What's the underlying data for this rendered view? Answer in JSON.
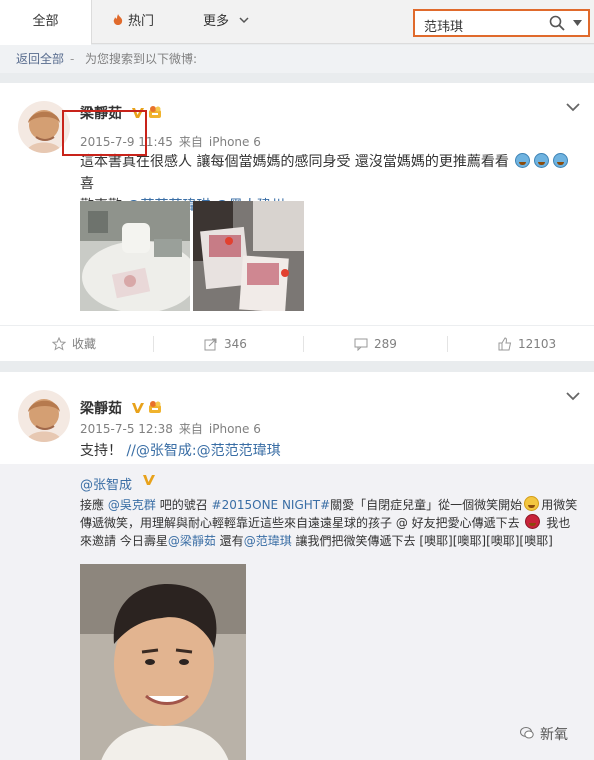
{
  "tabs": {
    "all": "全部",
    "hot": "热门",
    "more": "更多"
  },
  "search": {
    "value": "范玮琪"
  },
  "backbar": {
    "back": "返回全部",
    "sep": "-",
    "note": "为您搜索到以下微博:"
  },
  "post1": {
    "user": "梁靜茹",
    "date": "2015-7-9 11:45",
    "source_prefix": "来自",
    "source": "iPhone 6",
    "text_a": "這本書真在很感人 讓每個當媽媽的感同身受 還沒當媽媽的更推薦看看",
    "text_b": "喜",
    "text_c": "歡喜歡",
    "mention1": "@范范范瑋琪",
    "mention2": "@黑人建州",
    "actions": {
      "fav": "收藏",
      "repost": "346",
      "comment": "289",
      "like": "12103"
    }
  },
  "post2": {
    "user": "梁靜茹",
    "date": "2015-7-5 12:38",
    "source_prefix": "来自",
    "source": "iPhone 6",
    "text_a": "支持！",
    "mentions": "//@张智成:@范范范瑋琪",
    "quote": {
      "author": "@张智成",
      "p1_a": "接應",
      "p1_m1": "@吳克群",
      "p1_b": "吧的號召",
      "p1_tag": "#2015ONE NIGHT#",
      "p1_c": "關愛「自閉症兒童」從一個微笑開始",
      "p1_d": "用微笑傳遞微笑，用理解與耐心輕輕靠近這些來自遠遠星球的孩子 @ 好友把愛心傳遞下去",
      "p1_e": "我也來邀請 今日壽星",
      "p1_m2": "@梁靜茹",
      "p1_f": "還有",
      "p1_m3": "@范瑋琪",
      "p1_g": "讓我們把微笑傳遞下去 [噢耶][噢耶][噢耶][噢耶]"
    }
  },
  "watermark": "新氧",
  "colors": {
    "accent": "#e06a2c",
    "link": "#3a6ea5",
    "highlight": "#c8231a"
  }
}
